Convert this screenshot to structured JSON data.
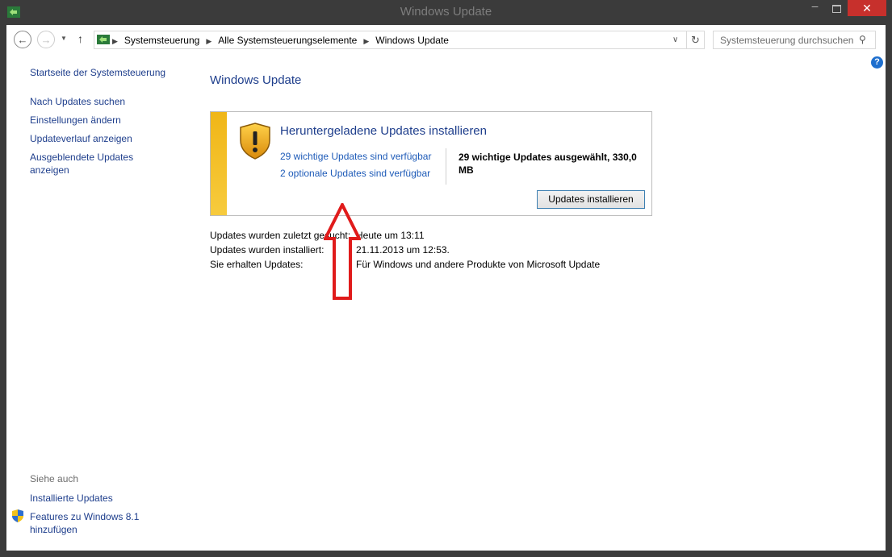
{
  "window": {
    "title": "Windows Update",
    "min_glyph": "–",
    "close_glyph": "✕"
  },
  "nav": {
    "back_glyph": "←",
    "forward_glyph": "→",
    "dropdown_glyph": "▼",
    "up_glyph": "↑",
    "breadcrumbs": [
      "Systemsteuerung",
      "Alle Systemsteuerungselemente",
      "Windows Update"
    ],
    "breadcrumb_sep": "▶",
    "addr_dropdown_glyph": "∨",
    "refresh_glyph": "↻",
    "search_placeholder": "Systemsteuerung durchsuchen",
    "search_glyph": "⚲",
    "help_glyph": "?"
  },
  "sidebar": {
    "home": "Startseite der Systemsteuerung",
    "items": [
      "Nach Updates suchen",
      "Einstellungen ändern",
      "Updateverlauf anzeigen",
      "Ausgeblendete Updates anzeigen"
    ],
    "see_also_title": "Siehe auch",
    "see_also": [
      "Installierte Updates",
      "Features zu Windows 8.1 hinzufügen"
    ]
  },
  "main": {
    "title": "Windows Update",
    "panel": {
      "heading": "Heruntergeladene Updates installieren",
      "important_link": "29 wichtige Updates sind verfügbar",
      "optional_link": "2 optionale Updates sind verfügbar",
      "selected_text": "29 wichtige Updates ausgewählt, 330,0 MB",
      "install_button": "Updates installieren"
    },
    "info": [
      {
        "label": "Updates wurden zuletzt gesucht:",
        "value": "Heute um 13:11"
      },
      {
        "label": "Updates wurden installiert:",
        "value": "21.11.2013 um 12:53."
      },
      {
        "label": "Sie erhalten Updates:",
        "value": "Für Windows und andere Produkte von Microsoft Update"
      }
    ]
  },
  "colors": {
    "link_dark": "#1e3e8c",
    "link_blue": "#1e5bb8",
    "stripe": "#f0b617",
    "arrow": "#e01b1b",
    "close_red": "#c7302c"
  }
}
